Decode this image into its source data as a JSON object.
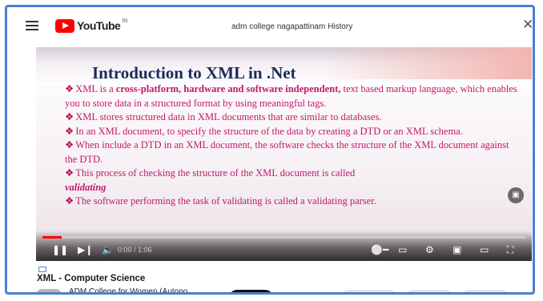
{
  "header": {
    "logo_text": "YouTube",
    "logo_sup": "IN",
    "search_value": "adm college nagapattinam History"
  },
  "slide": {
    "title": "Introduction to XML in .Net",
    "p1_pre": "XML is a ",
    "p1_bold": "cross-platform, hardware and software independent,",
    "p1_post": " text based markup language, which enables you to store data in a structured format by using meaningful tags.",
    "p2": "XML stores structured data in XML documents that are similar to databases.",
    "p3": "In an XML document, to specify the structure of the data by creating a DTD or an XML schema.",
    "p4": "When include a DTD in an XML document, the software checks the structure of the XML document against the DTD.",
    "p5": "This process of checking the structure of the XML document is called",
    "p5_italic": "validating",
    "p6": "The software performing the task of validating is called a validating parser."
  },
  "player": {
    "time": "0:00 / 1:06",
    "progress": 0.04
  },
  "video": {
    "title": "XML - Computer Science",
    "channel": "ADM College for Women (Autono..."
  }
}
